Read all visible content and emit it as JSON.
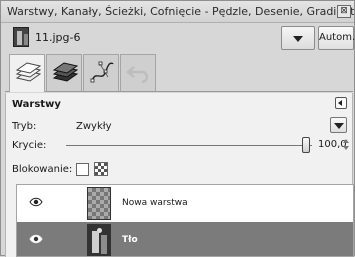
{
  "window": {
    "title": "Warstwy, Kanały, Ścieżki, Cofnięcie - Pędzle, Desenie, Gradienty",
    "close_glyph": "⊠"
  },
  "image_selector": {
    "name": "11.jpg-6",
    "dropdown_icon": "chevron-down-icon",
    "auto_label": "Autom."
  },
  "tabs": [
    {
      "name": "layers",
      "icon": "layers-icon",
      "active": true
    },
    {
      "name": "channels",
      "icon": "channels-icon",
      "active": false
    },
    {
      "name": "paths",
      "icon": "paths-icon",
      "active": false
    },
    {
      "name": "undo",
      "icon": "undo-icon",
      "active": false
    }
  ],
  "layers_panel": {
    "title": "Warstwy",
    "mode_label": "Tryb:",
    "mode_value": "Zwykły",
    "opacity_label": "Krycie:",
    "opacity_value": "100,0",
    "opacity_fraction": 1.0,
    "lock_label": "Blokowanie:",
    "lock_pixels_checked": false,
    "lock_alpha_checked": false
  },
  "layers": [
    {
      "name": "Nowa warstwa",
      "visible": true,
      "selected": false,
      "thumbnail": "transparent-checker"
    },
    {
      "name": "Tło",
      "visible": true,
      "selected": true,
      "thumbnail": "photo"
    }
  ],
  "colors": {
    "selected_row": "#7b7b7b",
    "panel_bg": "#f1f1f1",
    "window_bg": "#d7d7d7"
  }
}
